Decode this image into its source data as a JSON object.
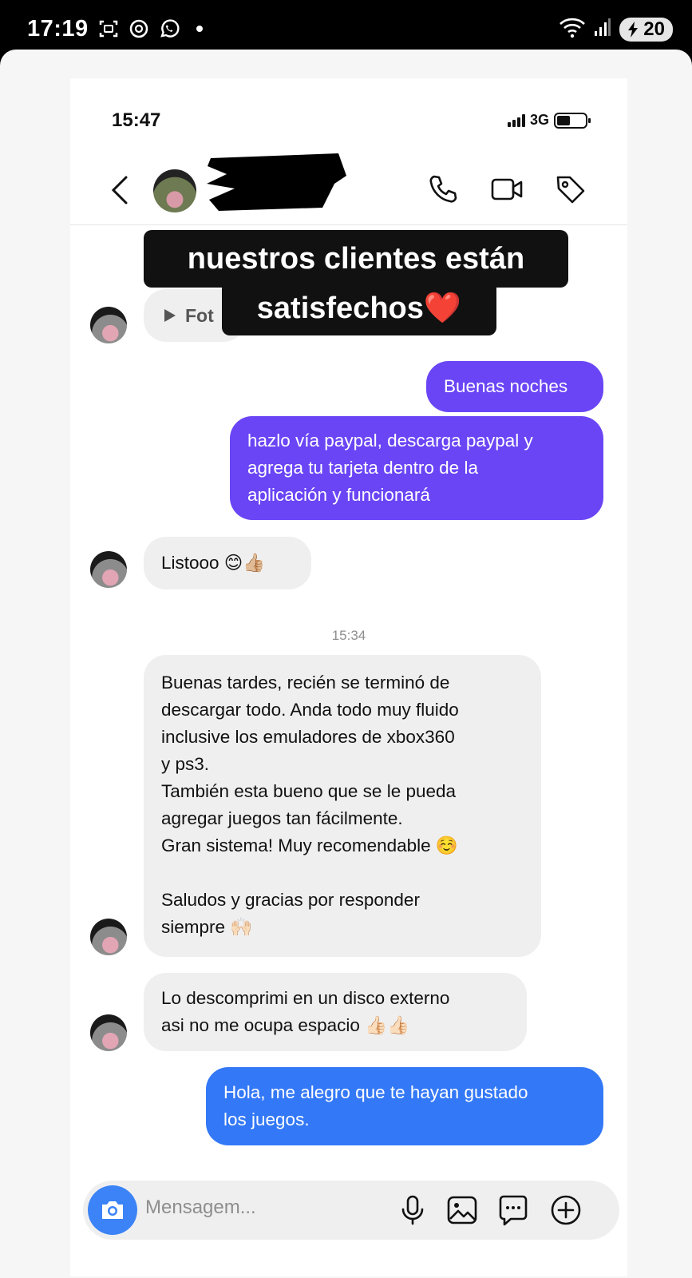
{
  "outer_status": {
    "time": "17:19",
    "battery": "20"
  },
  "ios_status": {
    "time": "15:47",
    "network": "3G"
  },
  "caption": {
    "line1": "nuestros clientes están",
    "line2": "satisfechos❤️"
  },
  "partial_bubble": {
    "label": "Fot"
  },
  "messages": [
    {
      "id": "m1",
      "side": "out",
      "color": "#6a45f5",
      "lines": [
        "Buenas noches"
      ]
    },
    {
      "id": "m2",
      "side": "out",
      "color": "#6a45f5",
      "lines": [
        "hazlo vía paypal, descarga paypal y",
        "agrega tu tarjeta dentro de la",
        "aplicación y funcionará"
      ]
    },
    {
      "id": "m3",
      "side": "in",
      "lines": [
        "Listooo 😊👍🏼"
      ]
    },
    {
      "id": "m4",
      "side": "in",
      "lines": [
        "Buenas tardes, recién se terminó de",
        "descargar todo. Anda todo muy fluido",
        "inclusive los emuladores de xbox360",
        "y ps3.",
        "También esta bueno que se le pueda",
        "agregar juegos tan fácilmente.",
        "Gran sistema! Muy recomendable ☺️",
        "",
        "Saludos y gracias por responder",
        "siempre 🙌🏻"
      ]
    },
    {
      "id": "m5",
      "side": "in",
      "lines": [
        "Lo descomprimi en un disco externo",
        "asi no me ocupa espacio 👍🏻👍🏻"
      ]
    },
    {
      "id": "m6",
      "side": "out",
      "color": "#3378f6",
      "lines": [
        "Hola, me alegro que te hayan gustado",
        "los juegos."
      ]
    }
  ],
  "timestamp": "15:34",
  "composer": {
    "placeholder": "Mensagem..."
  },
  "colors": {
    "accent_purple": "#6a45f5",
    "accent_blue": "#3378f6",
    "incoming_bg": "#efefef"
  },
  "icons": {
    "header": [
      "back-icon",
      "phone-icon",
      "video-icon",
      "tag-icon"
    ],
    "composer": [
      "camera-icon",
      "microphone-icon",
      "image-icon",
      "sticker-icon",
      "plus-icon"
    ]
  }
}
